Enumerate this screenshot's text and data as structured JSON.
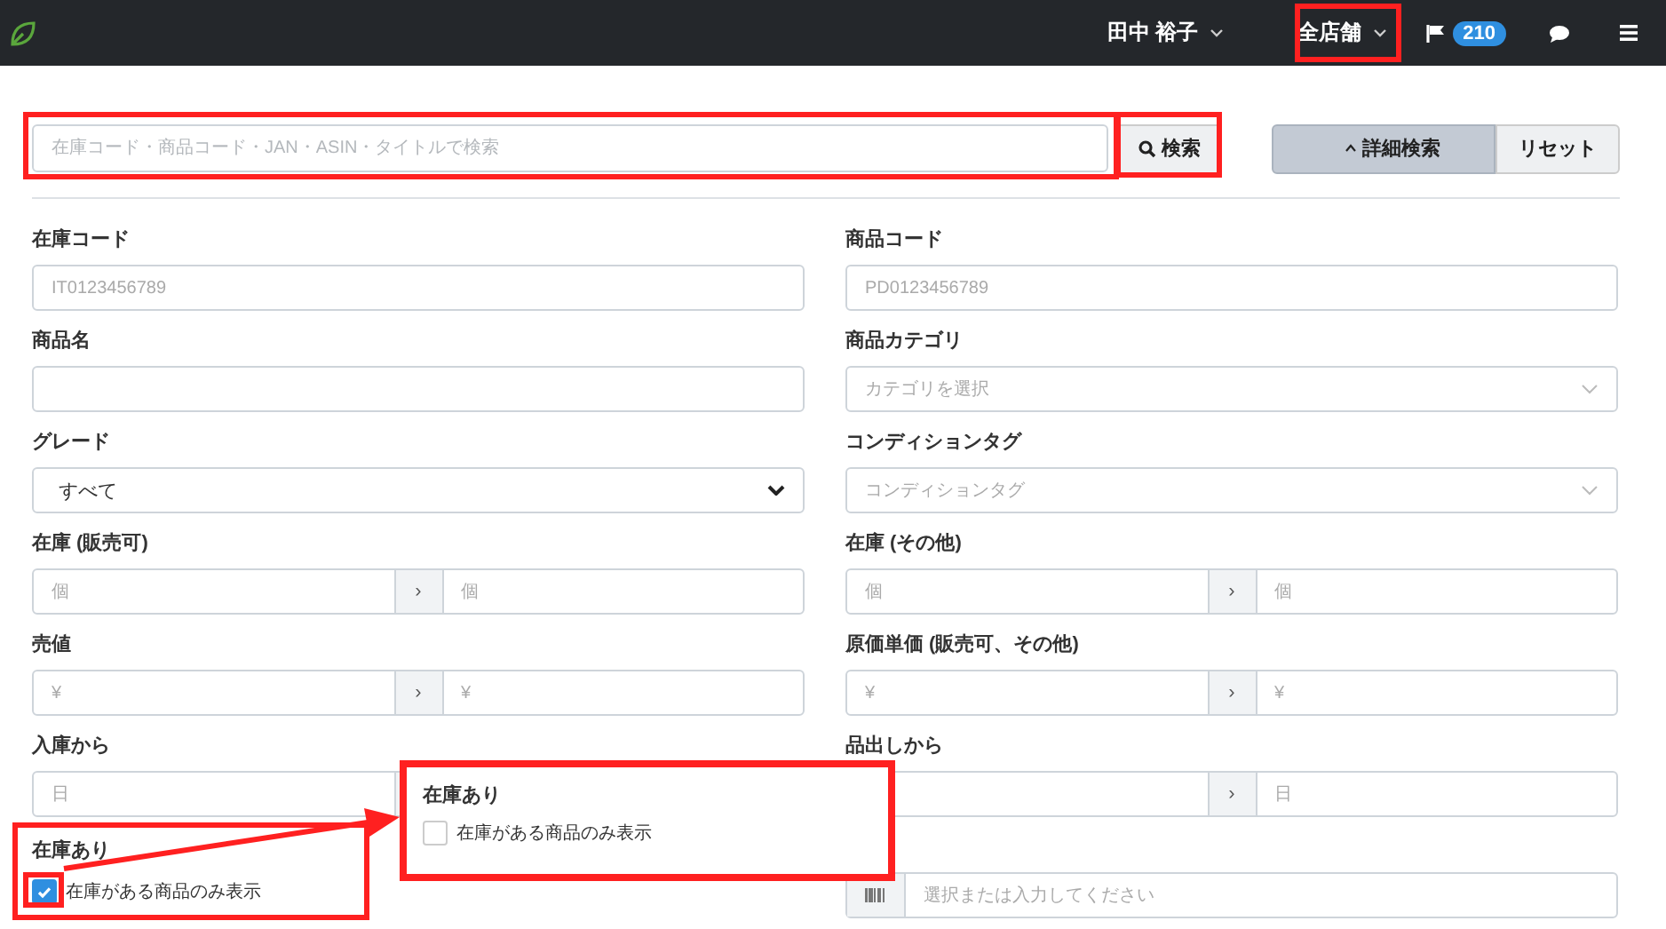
{
  "header": {
    "user": "田中 裕子",
    "store": "全店舗",
    "notification_count": "210"
  },
  "search": {
    "placeholder": "在庫コード・商品コード・JAN・ASIN・タイトルで検索",
    "button": "検索"
  },
  "actions": [
    {
      "label": "詳細検索",
      "pressed": true,
      "caret": true
    },
    {
      "label": "リセット",
      "pressed": false,
      "caret": false
    }
  ],
  "fields": [
    {
      "kind": "text",
      "label": "在庫コード",
      "placeholder": "IT0123456789"
    },
    {
      "kind": "text",
      "label": "商品コード",
      "placeholder": "PD0123456789"
    },
    {
      "kind": "text",
      "label": "商品名"
    },
    {
      "kind": "dropdown",
      "label": "商品カテゴリ",
      "placeholder": "カテゴリを選択"
    },
    {
      "kind": "select",
      "label": "グレード",
      "value": "すべて"
    },
    {
      "kind": "dropdown",
      "label": "コンディションタグ",
      "placeholder": "コンディションタグ"
    },
    {
      "kind": "range",
      "label": "在庫 (販売可)",
      "from": "個",
      "separator": "›",
      "to": "個"
    },
    {
      "kind": "range",
      "label": "在庫 (その他)",
      "from": "個",
      "separator": "›",
      "to": "個"
    },
    {
      "kind": "range",
      "label": "売値",
      "from": "¥",
      "separator": "›",
      "to": "¥"
    },
    {
      "kind": "range",
      "label": "原価単価 (販売可、その他)",
      "from": "¥",
      "separator": "›",
      "to": "¥"
    },
    {
      "kind": "range",
      "label": "入庫から",
      "from": "日"
    },
    {
      "kind": "range",
      "label": "品出しから",
      "separator": "›",
      "to": "日"
    },
    {
      "kind": "checkbox",
      "label": "在庫あり",
      "option": "在庫がある商品のみ表示",
      "checked": true
    },
    {
      "kind": "barcode",
      "placeholder": "選択または入力してください"
    }
  ],
  "callout": {
    "label": "在庫あり",
    "option": "在庫がある商品のみ表示",
    "checked": false
  }
}
